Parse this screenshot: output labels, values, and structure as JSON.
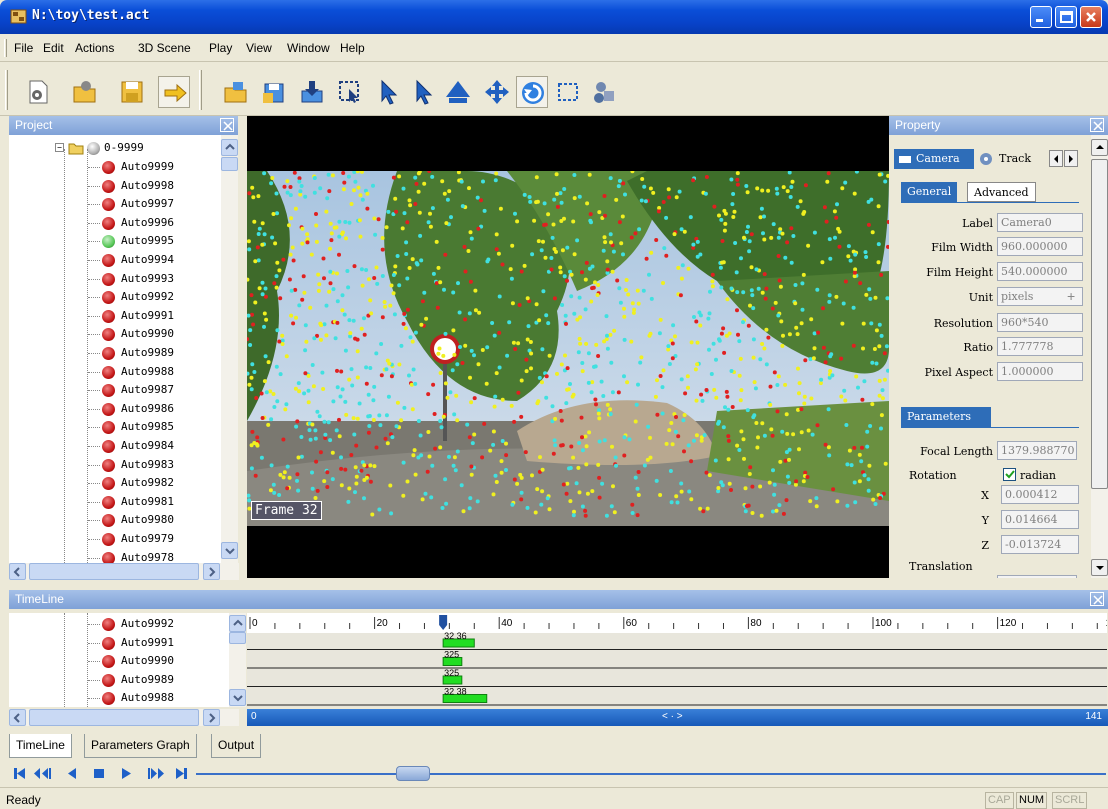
{
  "window": {
    "title": "N:\\toy\\test.act"
  },
  "menu": [
    {
      "label": "File"
    },
    {
      "label": "Edit"
    },
    {
      "label": "Actions"
    },
    {
      "label": "3D Scene"
    },
    {
      "label": "Play"
    },
    {
      "label": "View"
    },
    {
      "label": "Window"
    },
    {
      "label": "Help"
    }
  ],
  "toolbar": {
    "buttons": [
      {
        "icon": "new-project-icon"
      },
      {
        "icon": "open-project-icon"
      },
      {
        "icon": "save-project-icon"
      },
      {
        "icon": "arrow-next-icon"
      },
      {
        "icon": "open-folder-icon"
      },
      {
        "icon": "save-as-icon"
      },
      {
        "icon": "import-icon"
      },
      {
        "icon": "select-region-icon"
      },
      {
        "icon": "pointer-icon"
      },
      {
        "icon": "pointer-up-icon"
      },
      {
        "icon": "up-triangle-icon"
      },
      {
        "icon": "move-icon"
      },
      {
        "icon": "rotate-icon"
      },
      {
        "icon": "box-select-icon"
      },
      {
        "icon": "object-icon"
      }
    ]
  },
  "project": {
    "title": "Project",
    "root": "0-9999",
    "items": [
      {
        "label": "Auto9999",
        "color": "red"
      },
      {
        "label": "Auto9998",
        "color": "red"
      },
      {
        "label": "Auto9997",
        "color": "red"
      },
      {
        "label": "Auto9996",
        "color": "red"
      },
      {
        "label": "Auto9995",
        "color": "green"
      },
      {
        "label": "Auto9994",
        "color": "red"
      },
      {
        "label": "Auto9993",
        "color": "red"
      },
      {
        "label": "Auto9992",
        "color": "red"
      },
      {
        "label": "Auto9991",
        "color": "red"
      },
      {
        "label": "Auto9990",
        "color": "red"
      },
      {
        "label": "Auto9989",
        "color": "red"
      },
      {
        "label": "Auto9988",
        "color": "red"
      },
      {
        "label": "Auto9987",
        "color": "red"
      },
      {
        "label": "Auto9986",
        "color": "red"
      },
      {
        "label": "Auto9985",
        "color": "red"
      },
      {
        "label": "Auto9984",
        "color": "red"
      },
      {
        "label": "Auto9983",
        "color": "red"
      },
      {
        "label": "Auto9982",
        "color": "red"
      },
      {
        "label": "Auto9981",
        "color": "red"
      },
      {
        "label": "Auto9980",
        "color": "red"
      },
      {
        "label": "Auto9979",
        "color": "red"
      },
      {
        "label": "Auto9978",
        "color": "red"
      }
    ]
  },
  "viewport": {
    "frame_label": "Frame 32"
  },
  "property": {
    "title": "Property",
    "tabs": [
      {
        "label": "Camera"
      },
      {
        "label": "Track"
      }
    ],
    "subtabs": [
      {
        "label": "General"
      },
      {
        "label": "Advanced"
      }
    ],
    "fields": [
      {
        "label": "Label",
        "value": "Camera0"
      },
      {
        "label": "Film Width",
        "value": "960.000000"
      },
      {
        "label": "Film Height",
        "value": "540.000000"
      },
      {
        "label": "Unit",
        "value": "pixels"
      },
      {
        "label": "Resolution",
        "value": "960*540"
      },
      {
        "label": "Ratio",
        "value": "1.777778"
      },
      {
        "label": "Pixel Aspect",
        "value": "1.000000"
      }
    ],
    "parameters_tab": "Parameters",
    "focal_length": {
      "label": "Focal Length",
      "value": "1379.988770"
    },
    "rotation": {
      "label": "Rotation",
      "checkbox_label": "radian",
      "checked": true
    },
    "rotation_values": [
      {
        "axis": "X",
        "value": "0.000412"
      },
      {
        "axis": "Y",
        "value": "0.014664"
      },
      {
        "axis": "Z",
        "value": "-0.013724"
      }
    ],
    "translation_label": "Translation"
  },
  "timeline": {
    "title": "TimeLine",
    "items": [
      {
        "label": "Auto9992"
      },
      {
        "label": "Auto9991"
      },
      {
        "label": "Auto9990"
      },
      {
        "label": "Auto9989"
      },
      {
        "label": "Auto9988"
      }
    ],
    "ruler_labels": [
      "0",
      "20",
      "40",
      "60",
      "80",
      "100",
      "120",
      "1"
    ],
    "range_start": "0",
    "range_end": "141",
    "range_mid": "< · >",
    "track_labels": [
      "32 36",
      "325",
      "325",
      "32 38"
    ]
  },
  "bottom_tabs": [
    {
      "label": "TimeLine"
    },
    {
      "label": "Parameters Graph"
    },
    {
      "label": "Output"
    }
  ],
  "status": {
    "text": "Ready",
    "indicators": [
      "CAP",
      "NUM",
      "SCRL"
    ]
  },
  "colors": {
    "titlebar": "#0A4ED8",
    "panel_header": "#7FA1D7",
    "track_bar": "#22DD22"
  }
}
